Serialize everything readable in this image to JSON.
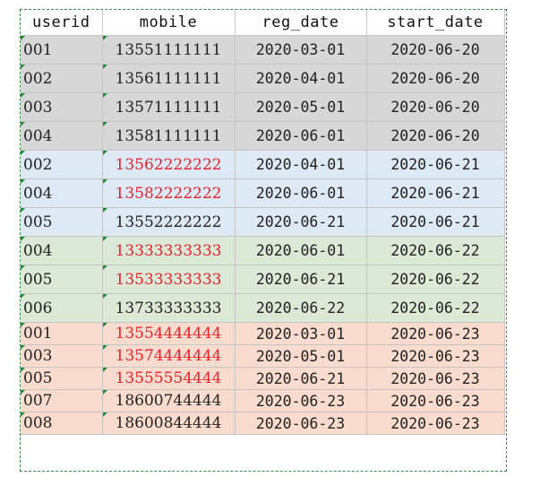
{
  "table": {
    "headers": [
      "userid",
      "mobile",
      "reg_date",
      "start_date"
    ],
    "rows": [
      {
        "userid": "001",
        "mobile": "13551111111",
        "reg_date": "2020-03-01",
        "start_date": "2020-06-20",
        "group": "gray",
        "mobile_color": "black"
      },
      {
        "userid": "002",
        "mobile": "13561111111",
        "reg_date": "2020-04-01",
        "start_date": "2020-06-20",
        "group": "gray",
        "mobile_color": "black"
      },
      {
        "userid": "003",
        "mobile": "13571111111",
        "reg_date": "2020-05-01",
        "start_date": "2020-06-20",
        "group": "gray",
        "mobile_color": "black"
      },
      {
        "userid": "004",
        "mobile": "13581111111",
        "reg_date": "2020-06-01",
        "start_date": "2020-06-20",
        "group": "gray",
        "mobile_color": "black"
      },
      {
        "userid": "002",
        "mobile": "13562222222",
        "reg_date": "2020-04-01",
        "start_date": "2020-06-21",
        "group": "blue",
        "mobile_color": "red"
      },
      {
        "userid": "004",
        "mobile": "13582222222",
        "reg_date": "2020-06-01",
        "start_date": "2020-06-21",
        "group": "blue",
        "mobile_color": "red"
      },
      {
        "userid": "005",
        "mobile": "13552222222",
        "reg_date": "2020-06-21",
        "start_date": "2020-06-21",
        "group": "blue",
        "mobile_color": "black"
      },
      {
        "userid": "004",
        "mobile": "13333333333",
        "reg_date": "2020-06-01",
        "start_date": "2020-06-22",
        "group": "green",
        "mobile_color": "red"
      },
      {
        "userid": "005",
        "mobile": "13533333333",
        "reg_date": "2020-06-21",
        "start_date": "2020-06-22",
        "group": "green",
        "mobile_color": "red"
      },
      {
        "userid": "006",
        "mobile": "13733333333",
        "reg_date": "2020-06-22",
        "start_date": "2020-06-22",
        "group": "green",
        "mobile_color": "black"
      },
      {
        "userid": "001",
        "mobile": "13554444444",
        "reg_date": "2020-03-01",
        "start_date": "2020-06-23",
        "group": "orange",
        "mobile_color": "red"
      },
      {
        "userid": "003",
        "mobile": "13574444444",
        "reg_date": "2020-05-01",
        "start_date": "2020-06-23",
        "group": "orange",
        "mobile_color": "red"
      },
      {
        "userid": "005",
        "mobile": "13555554444",
        "reg_date": "2020-06-21",
        "start_date": "2020-06-23",
        "group": "orange",
        "mobile_color": "red"
      },
      {
        "userid": "007",
        "mobile": "18600744444",
        "reg_date": "2020-06-23",
        "start_date": "2020-06-23",
        "group": "orange",
        "mobile_color": "black"
      },
      {
        "userid": "008",
        "mobile": "18600844444",
        "reg_date": "2020-06-23",
        "start_date": "2020-06-23",
        "group": "orange",
        "mobile_color": "black"
      }
    ]
  },
  "colors": {
    "gray": "#d7d7d7",
    "blue": "#dde9f5",
    "green": "#dbe9d6",
    "orange": "#fadcce",
    "red_text": "#e8222b",
    "selection_border": "#3f8f4a",
    "comment_marker": "#1e8a37"
  }
}
